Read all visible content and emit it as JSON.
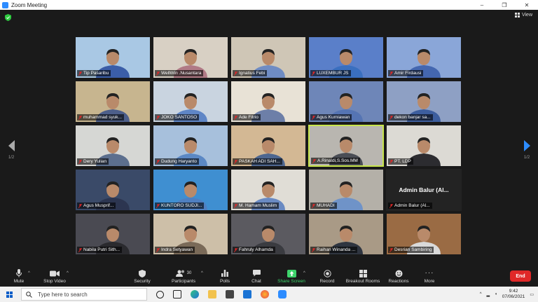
{
  "window": {
    "title": "Zoom Meeting",
    "controls": [
      "–",
      "❐",
      "✕"
    ]
  },
  "header": {
    "view_label": "View"
  },
  "pager": {
    "left_page": "1/2",
    "right_page": "1/2"
  },
  "participants": [
    {
      "name": "Tip Pasaribu",
      "bg": "#a9c8e4",
      "shirt": "#3b5ea8"
    },
    {
      "name": "WellWin .Nusantara",
      "bg": "#d8d0c4",
      "shirt": "#b07a86"
    },
    {
      "name": "Ignatius Febi",
      "bg": "#cfc6b6",
      "shirt": "#6f8cc4"
    },
    {
      "name": "LUXEMBUR JS",
      "bg": "#5a7fc9",
      "shirt": "#3a6fbf"
    },
    {
      "name": "Amir Firdausi",
      "bg": "#8aa6d8",
      "shirt": "#4467b0"
    },
    {
      "name": "muhammad syuk...",
      "bg": "#c7b58f",
      "shirt": "#4d5f8a"
    },
    {
      "name": "JOKO SANTOSO",
      "bg": "#c9d4e0",
      "shirt": "#5f86c6"
    },
    {
      "name": "Ade Fitrio",
      "bg": "#e8e2d6",
      "shirt": "#6d7fa8"
    },
    {
      "name": "Agus Kurniawan",
      "bg": "#6e86b8",
      "shirt": "#5574b3"
    },
    {
      "name": "dekon banjar sa...",
      "bg": "#8ea0c4",
      "shirt": "#3d5e9e"
    },
    {
      "name": "Dery Yulian",
      "bg": "#d6d7d4",
      "shirt": "#5c6f8e"
    },
    {
      "name": "Dudung Haryanto",
      "bg": "#a7c0dc",
      "shirt": "#5b88c4"
    },
    {
      "name": "PASKAH ADI SAH...",
      "bg": "#d3b894",
      "shirt": "#4e6790"
    },
    {
      "name": "A.Rinaldi,S.Sos.MM",
      "bg": "#b9b6b0",
      "shirt": "#4a4d55",
      "active": true
    },
    {
      "name": "PT. LDP",
      "bg": "#dcdad4",
      "shirt": "#2c2c30"
    },
    {
      "name": "Agus Musprif...",
      "bg": "#3a4a68",
      "shirt": "#2c3550"
    },
    {
      "name": "KUNTORO SUDJI...",
      "bg": "#3f8fd1",
      "shirt": "#4f7fc0"
    },
    {
      "name": "M. Hamam Muslim",
      "bg": "#e0ddd6",
      "shirt": "#6a8ac2"
    },
    {
      "name": "MUHADI",
      "bg": "#b4b0a8",
      "shirt": "#6f93c8"
    },
    {
      "name": "Admin Balur (Al...",
      "no_video": true
    },
    {
      "name": "Nabila Putri Sith...",
      "bg": "#4a4a52",
      "shirt": "#2a2a2e"
    },
    {
      "name": "Indra Setyawan",
      "bg": "#cdbfa8",
      "shirt": "#7a6a58"
    },
    {
      "name": "Fahruly Alhamda",
      "bg": "#5b5a60",
      "shirt": "#3a3b40"
    },
    {
      "name": "Raihan Winanda ...",
      "bg": "#a99a86",
      "shirt": "#2f3540"
    },
    {
      "name": "Desrian Sambiring",
      "bg": "#9a6b44",
      "shirt": "#d9d9d9"
    }
  ],
  "toolbar": {
    "mute": "Mute",
    "stop_video": "Stop Video",
    "security": "Security",
    "participants": "Participants",
    "participants_count": "30",
    "polls": "Polls",
    "chat": "Chat",
    "share_screen": "Share Screen",
    "record": "Record",
    "breakout_rooms": "Breakout Rooms",
    "reactions": "Reactions",
    "more": "More",
    "end": "End"
  },
  "taskbar": {
    "search_placeholder": "Type here to search",
    "time": "9:42",
    "date": "07/06/2021"
  },
  "colors": {
    "accent": "#2d8cff",
    "share": "#3dd36b",
    "end": "#e02828",
    "active_speaker": "#c8e64b"
  }
}
